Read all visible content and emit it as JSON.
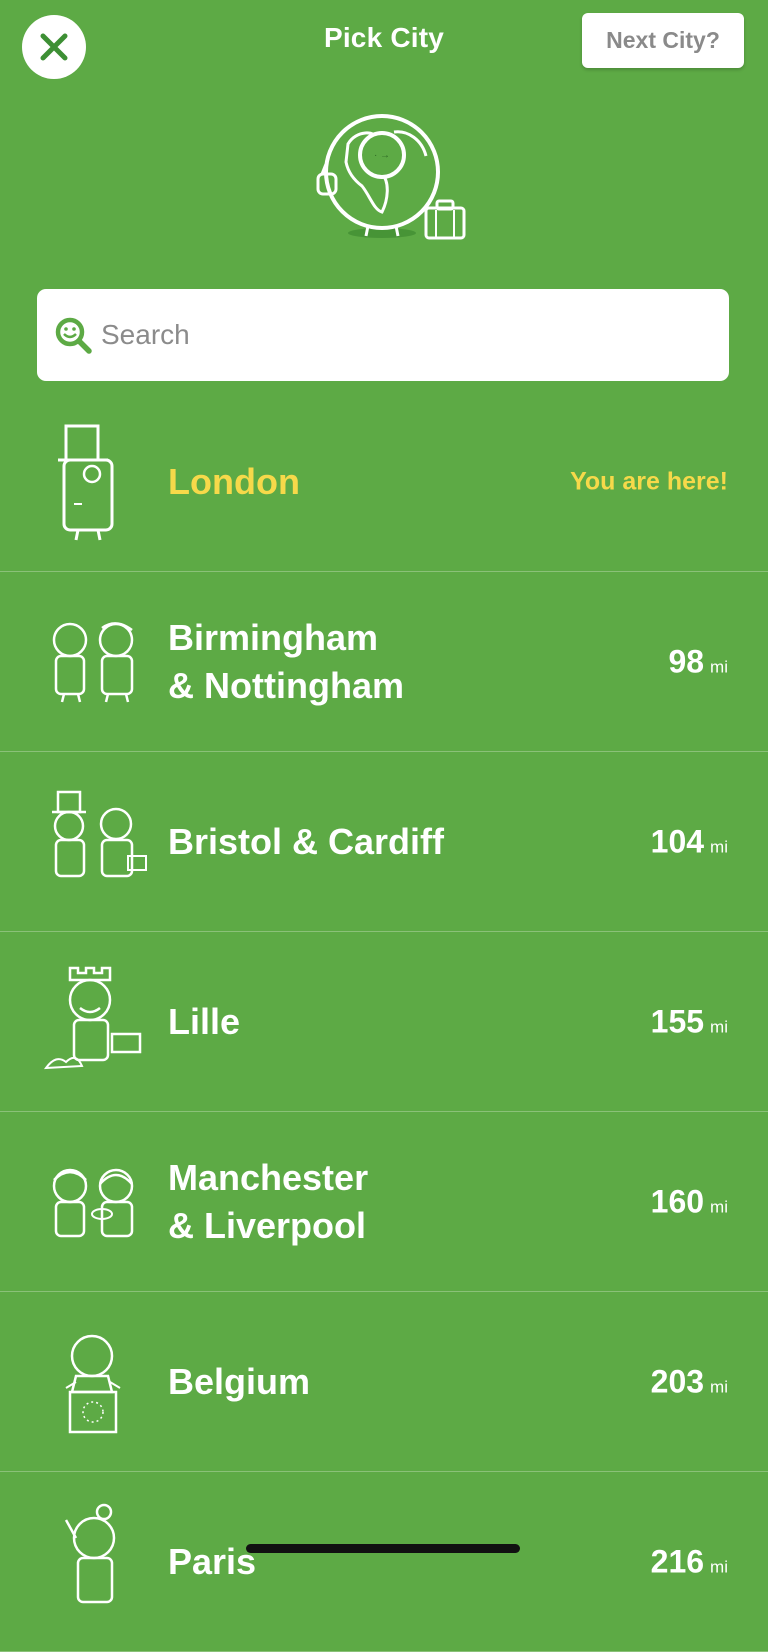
{
  "header": {
    "title": "Pick City",
    "next_city_label": "Next City?",
    "close_icon": "close-icon"
  },
  "search": {
    "placeholder": "Search",
    "value": ""
  },
  "current_city": {
    "name": "London",
    "status": "You are here!"
  },
  "cities": [
    {
      "name_line1": "Birmingham",
      "name_line2": "& Nottingham",
      "distance": "98",
      "unit": "mi"
    },
    {
      "name_line1": "Bristol & Cardiff",
      "name_line2": "",
      "distance": "104",
      "unit": "mi"
    },
    {
      "name_line1": "Lille",
      "name_line2": "",
      "distance": "155",
      "unit": "mi"
    },
    {
      "name_line1": "Manchester",
      "name_line2": "& Liverpool",
      "distance": "160",
      "unit": "mi"
    },
    {
      "name_line1": "Belgium",
      "name_line2": "",
      "distance": "203",
      "unit": "mi"
    },
    {
      "name_line1": "Paris",
      "name_line2": "",
      "distance": "216",
      "unit": "mi"
    }
  ],
  "colors": {
    "background": "#5daa45",
    "highlight": "#f6d94a",
    "close_icon": "#3d8f34"
  }
}
